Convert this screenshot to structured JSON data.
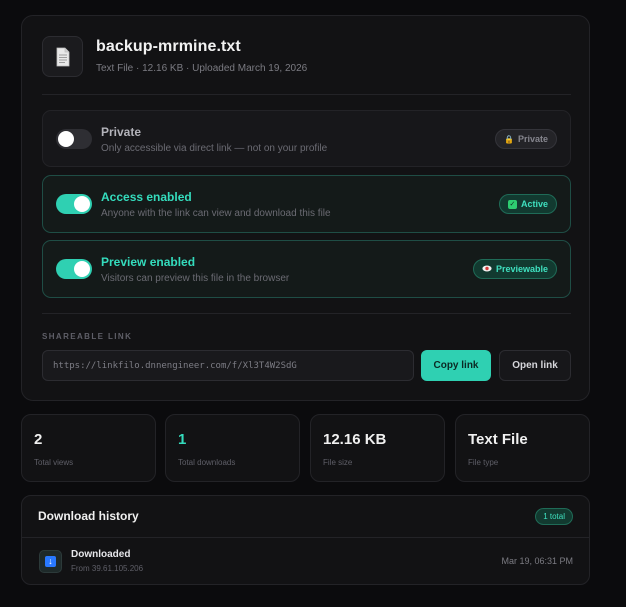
{
  "file": {
    "name": "backup-mrmine.txt",
    "meta": "Text File · 12.16 KB · Uploaded March 19, 2026",
    "icon": "document-icon"
  },
  "settings": [
    {
      "title": "Private",
      "description": "Only accessible via direct link — not on your profile",
      "enabled": false,
      "badge": "Private",
      "badge_icon": "lock-icon"
    },
    {
      "title": "Access enabled",
      "description": "Anyone with the link can view and download this file",
      "enabled": true,
      "badge": "Active",
      "badge_icon": "check-icon"
    },
    {
      "title": "Preview enabled",
      "description": "Visitors can preview this file in the browser",
      "enabled": true,
      "badge": "Previewable",
      "badge_icon": "eye-icon"
    }
  ],
  "share": {
    "label": "SHAREABLE LINK",
    "url": "https://linkfilo.dnnengineer.com/f/Xl3T4W2SdG",
    "copy_label": "Copy link",
    "open_label": "Open link"
  },
  "stats": [
    {
      "value": "2",
      "label": "Total views"
    },
    {
      "value": "1",
      "label": "Total downloads"
    },
    {
      "value": "12.16 KB",
      "label": "File size"
    },
    {
      "value": "Text File",
      "label": "File type"
    }
  ],
  "history": {
    "title": "Download history",
    "total_badge": "1 total",
    "events": [
      {
        "title": "Downloaded",
        "source": "From 39.61.105.206",
        "time": "Mar 19, 06:31 PM",
        "icon": "download-icon"
      }
    ]
  },
  "colors": {
    "accent": "#2fd0b2",
    "background": "#0b0b0d",
    "card": "#121214"
  }
}
